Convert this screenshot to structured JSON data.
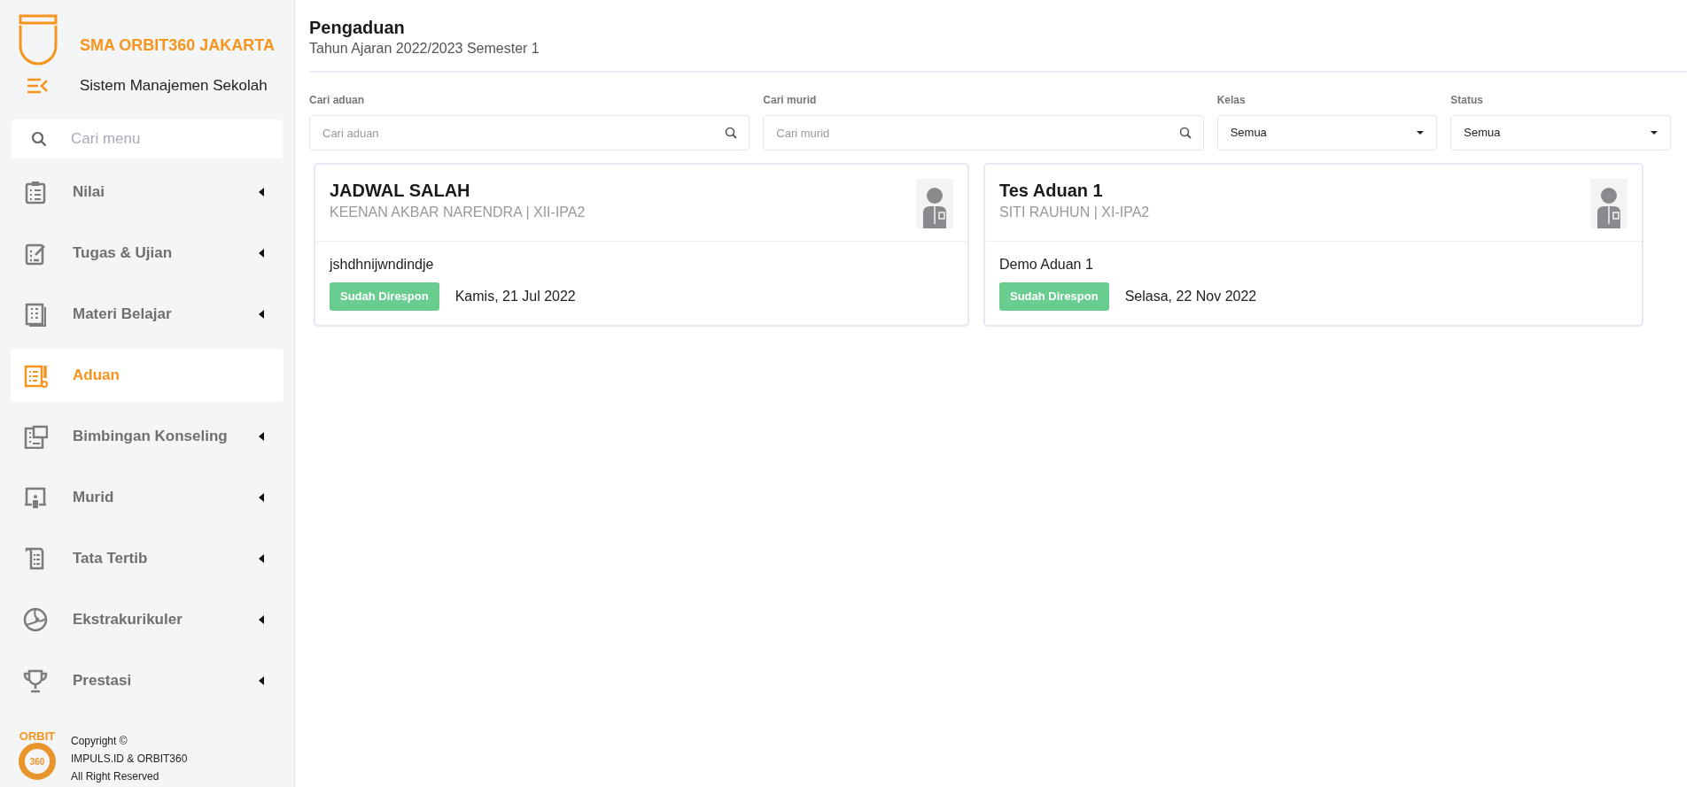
{
  "sidebar": {
    "school_name": "SMA ORBIT360 JAKARTA",
    "app_name": "Sistem Manajemen Sekolah",
    "search": {
      "placeholder": "Cari menu"
    },
    "items": [
      {
        "label": "Nilai",
        "selected": false,
        "expandable": true
      },
      {
        "label": "Tugas & Ujian",
        "selected": false,
        "expandable": true
      },
      {
        "label": "Materi Belajar",
        "selected": false,
        "expandable": true
      },
      {
        "label": "Aduan",
        "selected": true,
        "expandable": false
      },
      {
        "label": "Bimbingan Konseling",
        "selected": false,
        "expandable": true
      },
      {
        "label": "Murid",
        "selected": false,
        "expandable": true
      },
      {
        "label": "Tata Tertib",
        "selected": false,
        "expandable": true
      },
      {
        "label": "Ekstrakurikuler",
        "selected": false,
        "expandable": true
      },
      {
        "label": "Prestasi",
        "selected": false,
        "expandable": true
      }
    ],
    "footer": {
      "logo_text": "ORBIT",
      "logo_number": "360",
      "lines": [
        "Copyright ©",
        "IMPULS.ID & ORBIT360",
        "All Right Reserved"
      ]
    }
  },
  "page": {
    "title": "Pengaduan",
    "subtitle": "Tahun Ajaran 2022/2023 Semester 1"
  },
  "filters": [
    {
      "kind": "search",
      "label": "Cari aduan",
      "placeholder": "Cari aduan"
    },
    {
      "kind": "search",
      "label": "Cari murid",
      "placeholder": "Cari murid"
    },
    {
      "kind": "select",
      "label": "Kelas",
      "value": "Semua"
    },
    {
      "kind": "select",
      "label": "Status",
      "value": "Semua"
    }
  ],
  "complaints": [
    {
      "title": "JADWAL SALAH",
      "student": "KEENAN AKBAR NARENDRA | XII-IPA2",
      "text": "jshdhnijwndindje",
      "status": "Sudah Direspon",
      "color": "#68cd8f",
      "date": "Kamis, 21 Jul 2022"
    },
    {
      "title": "Tes Aduan 1",
      "student": "SITI RAUHUN | XI-IPA2",
      "text": "Demo Aduan 1",
      "status": "Sudah Direspon",
      "color": "#68cd8f",
      "date": "Selasa, 22 Nov 2022"
    }
  ]
}
